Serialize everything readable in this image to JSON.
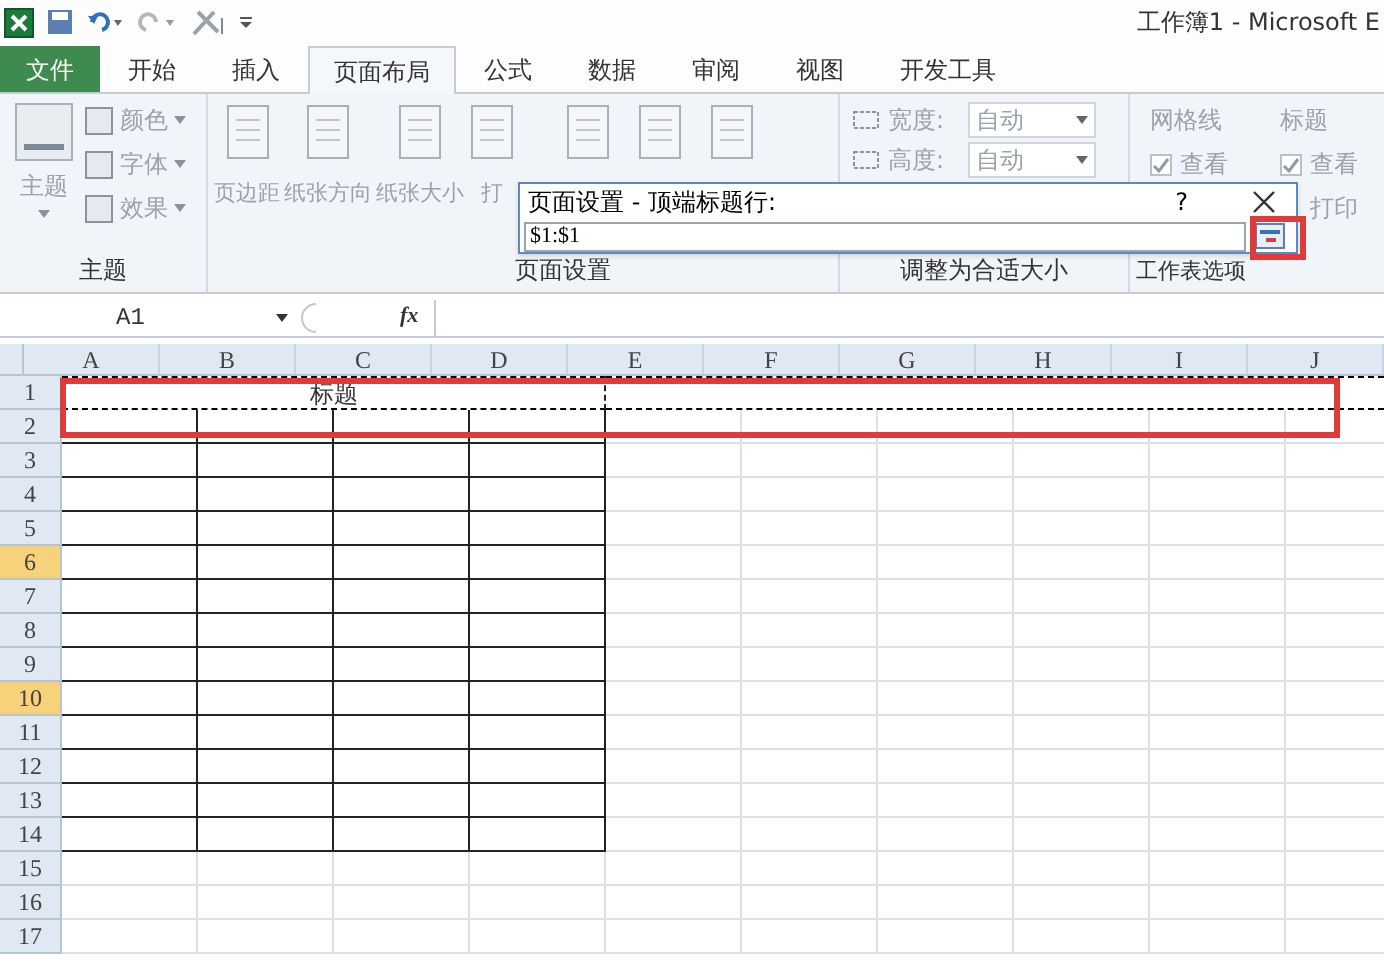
{
  "window": {
    "title": "工作簿1 - Microsoft E"
  },
  "tabs": [
    {
      "label": "文件",
      "kind": "file",
      "selected": false
    },
    {
      "label": "开始",
      "kind": "tab",
      "selected": false
    },
    {
      "label": "插入",
      "kind": "tab",
      "selected": false
    },
    {
      "label": "页面布局",
      "kind": "tab",
      "selected": true
    },
    {
      "label": "公式",
      "kind": "tab",
      "selected": false
    },
    {
      "label": "数据",
      "kind": "tab",
      "selected": false
    },
    {
      "label": "审阅",
      "kind": "tab",
      "selected": false
    },
    {
      "label": "视图",
      "kind": "tab",
      "selected": false
    },
    {
      "label": "开发工具",
      "kind": "tab",
      "selected": false
    }
  ],
  "ribbon": {
    "themes": {
      "label": "主题",
      "big": "主题",
      "small": [
        "颜色",
        "字体",
        "效果"
      ]
    },
    "page_setup": {
      "label": "页面设置",
      "buttons": [
        "页边距",
        "纸张方向",
        "纸张大小",
        "打"
      ]
    },
    "scale": {
      "label": "调整为合适大小",
      "rows": [
        {
          "label": "宽度:",
          "value": "自动"
        },
        {
          "label": "高度:",
          "value": "自动"
        }
      ]
    },
    "sheet_options": {
      "label": "工作表选项",
      "columns": [
        {
          "label": "网格线",
          "options": [
            {
              "label": "查看",
              "checked": true
            }
          ]
        },
        {
          "label": "标题",
          "options": [
            {
              "label": "查看",
              "checked": true
            },
            {
              "label": "打印"
            }
          ]
        }
      ]
    }
  },
  "dialog": {
    "title": "页面设置 - 顶端标题行:",
    "help": "?",
    "value": "$1:$1"
  },
  "formula_bar": {
    "name_box": "A1",
    "function_label": "fx"
  },
  "sheet": {
    "columns": [
      "A",
      "B",
      "C",
      "D",
      "E",
      "F",
      "G",
      "H",
      "I",
      "J"
    ],
    "title_cell": "标题",
    "rows": [
      {
        "label": "1",
        "selected": false,
        "bordered": true,
        "marquee": true
      },
      {
        "label": "2",
        "selected": false,
        "bordered": true,
        "marquee": false
      },
      {
        "label": "3",
        "selected": false,
        "bordered": true,
        "marquee": false
      },
      {
        "label": "4",
        "selected": false,
        "bordered": true,
        "marquee": false
      },
      {
        "label": "5",
        "selected": false,
        "bordered": true,
        "marquee": false
      },
      {
        "label": "6",
        "selected": true,
        "bordered": true,
        "marquee": false
      },
      {
        "label": "7",
        "selected": false,
        "bordered": true,
        "marquee": false
      },
      {
        "label": "8",
        "selected": false,
        "bordered": true,
        "marquee": false
      },
      {
        "label": "9",
        "selected": false,
        "bordered": true,
        "marquee": false
      },
      {
        "label": "10",
        "selected": true,
        "bordered": true,
        "marquee": false
      },
      {
        "label": "11",
        "selected": false,
        "bordered": true,
        "marquee": false
      },
      {
        "label": "12",
        "selected": false,
        "bordered": true,
        "marquee": false
      },
      {
        "label": "13",
        "selected": false,
        "bordered": true,
        "marquee": false
      },
      {
        "label": "14",
        "selected": false,
        "bordered": true,
        "marquee": false
      },
      {
        "label": "15",
        "selected": false,
        "bordered": false,
        "marquee": false
      },
      {
        "label": "16",
        "selected": false,
        "bordered": false,
        "marquee": false
      },
      {
        "label": "17",
        "selected": false,
        "bordered": false,
        "marquee": false
      }
    ]
  }
}
